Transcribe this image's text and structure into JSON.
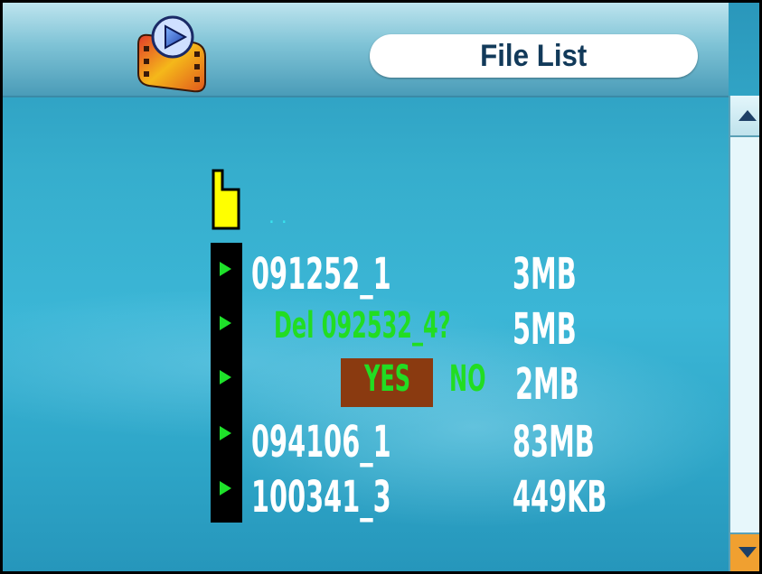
{
  "header": {
    "title": "File List"
  },
  "parent_dir": "..",
  "files": [
    {
      "name": "091252_1",
      "size": "3MB"
    },
    {
      "name": "",
      "size": "5MB"
    },
    {
      "name": "",
      "size": "2MB"
    },
    {
      "name": "094106_1",
      "size": "83MB"
    },
    {
      "name": "100341_3",
      "size": "449KB"
    }
  ],
  "dialog": {
    "message": "Del 092532_4?",
    "yes_label": "YES",
    "no_label": "NO"
  },
  "icons": {
    "logo": "video-player-logo-icon",
    "folder": "folder-icon",
    "cursor": "play-arrow-icon",
    "scroll_up": "scroll-up-arrow-icon",
    "scroll_down": "scroll-down-arrow-icon"
  },
  "colors": {
    "background": "#36aecd",
    "file_text": "#ffffff",
    "dialog_text": "#22dd22",
    "yes_highlight": "#8a3a10",
    "cursor": "#1ee12a",
    "folder": "#ffff00"
  }
}
